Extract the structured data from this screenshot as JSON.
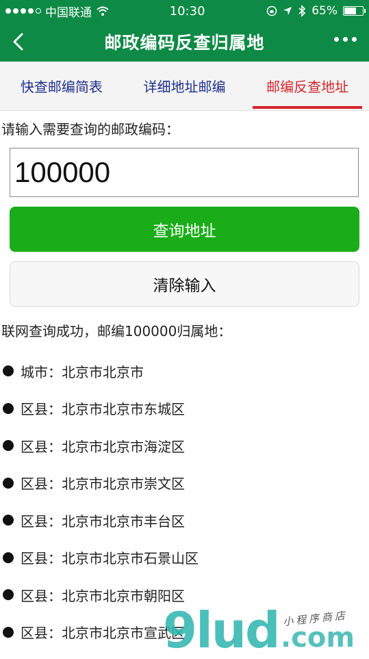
{
  "status_bar": {
    "carrier": "中国联通",
    "time": "10:30",
    "battery": "65%",
    "battery_level": 0.65,
    "icons": [
      "signal-dots-icon",
      "wifi-icon",
      "lock-rotation-icon",
      "location-arrow-icon",
      "bluetooth-icon",
      "battery-icon"
    ]
  },
  "nav": {
    "title": "邮政编码反查归属地",
    "back_icon": "chevron-left-icon",
    "more_icon": "more-dots-icon"
  },
  "tabs": [
    {
      "label": "快查邮编简表",
      "active": false
    },
    {
      "label": "详细地址邮编",
      "active": false
    },
    {
      "label": "邮编反查地址",
      "active": true
    }
  ],
  "form": {
    "prompt": "请输入需要查询的邮政编码：",
    "input_value": "100000",
    "query_button": "查询地址",
    "clear_button": "清除输入"
  },
  "result": {
    "heading": "联网查询成功，邮编100000归属地：",
    "items": [
      {
        "key": "城市",
        "sep": "：",
        "value": "北京市北京市"
      },
      {
        "key": "区县",
        "sep": "：",
        "value": "北京市北京市东城区"
      },
      {
        "key": "区县",
        "sep": "：",
        "value": "北京市北京市海淀区"
      },
      {
        "key": "区县",
        "sep": "：",
        "value": "北京市北京市崇文区"
      },
      {
        "key": "区县",
        "sep": "：",
        "value": "北京市北京市丰台区"
      },
      {
        "key": "区县",
        "sep": "：",
        "value": "北京市北京市石景山区"
      },
      {
        "key": "区县",
        "sep": "：",
        "value": "北京市北京市朝阳区"
      },
      {
        "key": "区县",
        "sep": "：",
        "value": "北京市北京市宣武区"
      }
    ]
  },
  "watermark": {
    "big": "9lud",
    "com": ".com",
    "small": "小程序商店"
  },
  "colors": {
    "nav_green": "#0d8a45",
    "button_green": "#1aad19",
    "tab_blue": "#1e2f8c",
    "tab_active_red": "#d3252c"
  }
}
